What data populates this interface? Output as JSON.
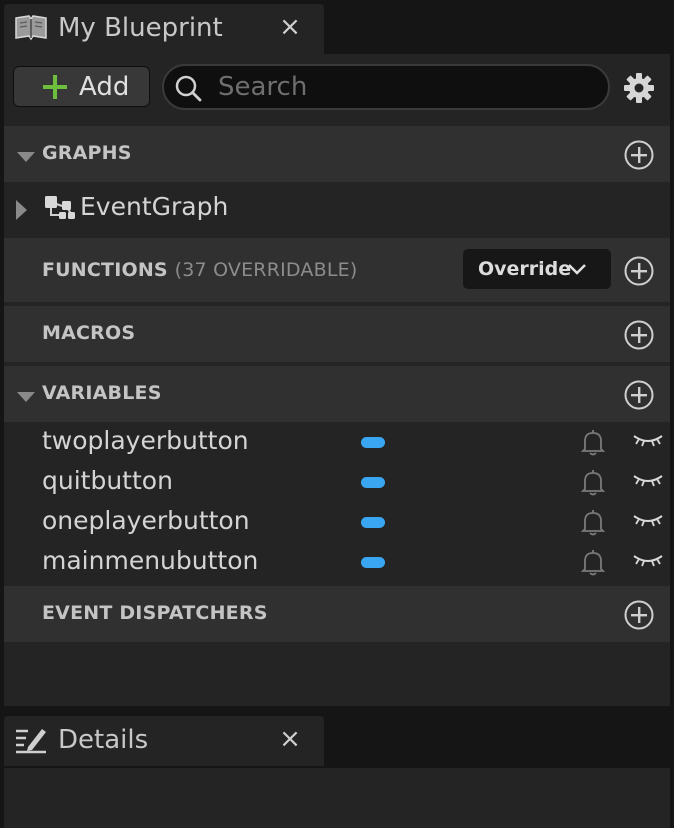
{
  "blueprint_tab": {
    "title": "My Blueprint",
    "close": "×"
  },
  "toolbar": {
    "add_label": "Add",
    "search_placeholder": "Search"
  },
  "sections": {
    "graphs": {
      "label": "GRAPHS"
    },
    "event_graph": {
      "label": "EventGraph"
    },
    "functions": {
      "label": "FUNCTIONS",
      "sub": "(37 OVERRIDABLE)",
      "override_label": "Override"
    },
    "macros": {
      "label": "MACROS"
    },
    "variables": {
      "label": "VARIABLES"
    },
    "event_dispatchers": {
      "label": "EVENT DISPATCHERS"
    }
  },
  "variables": [
    {
      "name": "twoplayerbutton"
    },
    {
      "name": "quitbutton"
    },
    {
      "name": "oneplayerbutton"
    },
    {
      "name": "mainmenubutton"
    }
  ],
  "details_tab": {
    "title": "Details",
    "close": "×"
  },
  "colors": {
    "accent_green": "#6fbf3f",
    "variable_pill": "#3aa6f2"
  }
}
